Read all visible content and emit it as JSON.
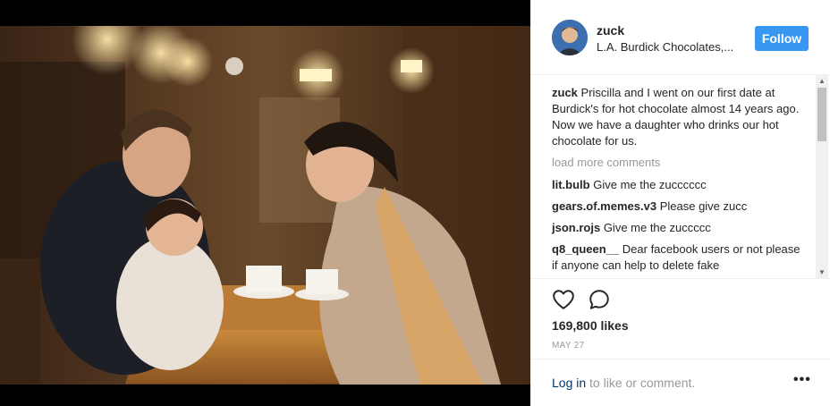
{
  "post": {
    "username": "zuck",
    "location": "L.A. Burdick Chocolates,...",
    "follow_label": "Follow",
    "caption": {
      "user": "zuck",
      "text": "Priscilla and I went on our first date at Burdick's for hot chocolate almost 14 years ago. Now we have a daughter who drinks our hot chocolate for us."
    },
    "load_more": "load more comments",
    "comments": [
      {
        "user": "lit.bulb",
        "text": "Give me the zucccccc"
      },
      {
        "user": "gears.of.memes.v3",
        "text": "Please give zucc"
      },
      {
        "user": "json.rojs",
        "text": "Give me the zuccccc"
      },
      {
        "user": "q8_queen__",
        "text": "Dear facebook users or not please if anyone can help to delete fake"
      }
    ],
    "likes": "169,800 likes",
    "date": "MAY 27",
    "login_link": "Log in",
    "login_rest": " to like or comment.",
    "more_label": "•••"
  },
  "icons": {
    "like": "heart-icon",
    "comment": "comment-icon",
    "more": "more-options-icon",
    "scroll_up": "scroll-up-arrow",
    "scroll_down": "scroll-down-arrow"
  },
  "colors": {
    "follow_button": "#3897f0",
    "link": "#003569",
    "muted": "#999999",
    "text": "#262626"
  }
}
